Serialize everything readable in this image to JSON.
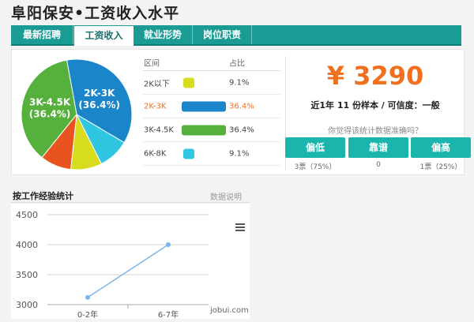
{
  "page": {
    "title": "阜阳保安•工资收入水平"
  },
  "tabs": [
    {
      "label": "最新招聘",
      "active": false
    },
    {
      "label": "工资收入",
      "active": true
    },
    {
      "label": "就业形势",
      "active": false
    },
    {
      "label": "岗位职责",
      "active": false
    }
  ],
  "distribution": {
    "header": {
      "range": "区间",
      "percent": "占比"
    },
    "rows": [
      {
        "range": "2K以下",
        "percent": "9.1%",
        "value": 9.1,
        "color": "#d8dc1e"
      },
      {
        "range": "2K-3K",
        "percent": "36.4%",
        "value": 36.4,
        "color": "#1a85c8",
        "highlight": true
      },
      {
        "range": "3K-4.5K",
        "percent": "36.4%",
        "value": 36.4,
        "color": "#55b03c"
      },
      {
        "range": "6K-8K",
        "percent": "9.1%",
        "value": 9.1,
        "color": "#2ec6e0"
      }
    ]
  },
  "pie": {
    "slices": [
      {
        "name": "2K-3K",
        "value": 36.4,
        "color": "#1a85c8",
        "label": "2K-3K",
        "sublabel": "(36.4%)"
      },
      {
        "name": "6K-8K",
        "value": 9.1,
        "color": "#2ec6e0"
      },
      {
        "name": "2K以下",
        "value": 9.1,
        "color": "#d8dc1e"
      },
      {
        "name": "unlabeled-orange",
        "value": 9.1,
        "color": "#e8531f"
      },
      {
        "name": "3K-4.5K",
        "value": 36.4,
        "color": "#55b03c",
        "label": "3K-4.5K",
        "sublabel": "(36.4%)"
      }
    ]
  },
  "summary": {
    "salary": "¥ 3290",
    "sample_text": "近1年 11 份样本 / 可信度：一般",
    "question": "你觉得该统计数据准确吗？"
  },
  "votes": [
    {
      "label": "偏低",
      "count": "3票（75%）"
    },
    {
      "label": "靠谱",
      "count": "0"
    },
    {
      "label": "偏高",
      "count": "1票（25%）"
    }
  ],
  "experience_section": {
    "title": "按工作经验统计",
    "link": "数据说明",
    "menu_icon": "hamburger-menu-icon"
  },
  "chart_data": {
    "type": "line",
    "categories": [
      "0-2年",
      "6-7年"
    ],
    "series": [
      {
        "values": [
          3120,
          4000
        ],
        "color": "#7cb5ec"
      }
    ],
    "yticks": [
      3000,
      3500,
      4000,
      4500
    ],
    "ylim": [
      3000,
      4500
    ],
    "grid": true
  },
  "watermark": "jobui.com"
}
